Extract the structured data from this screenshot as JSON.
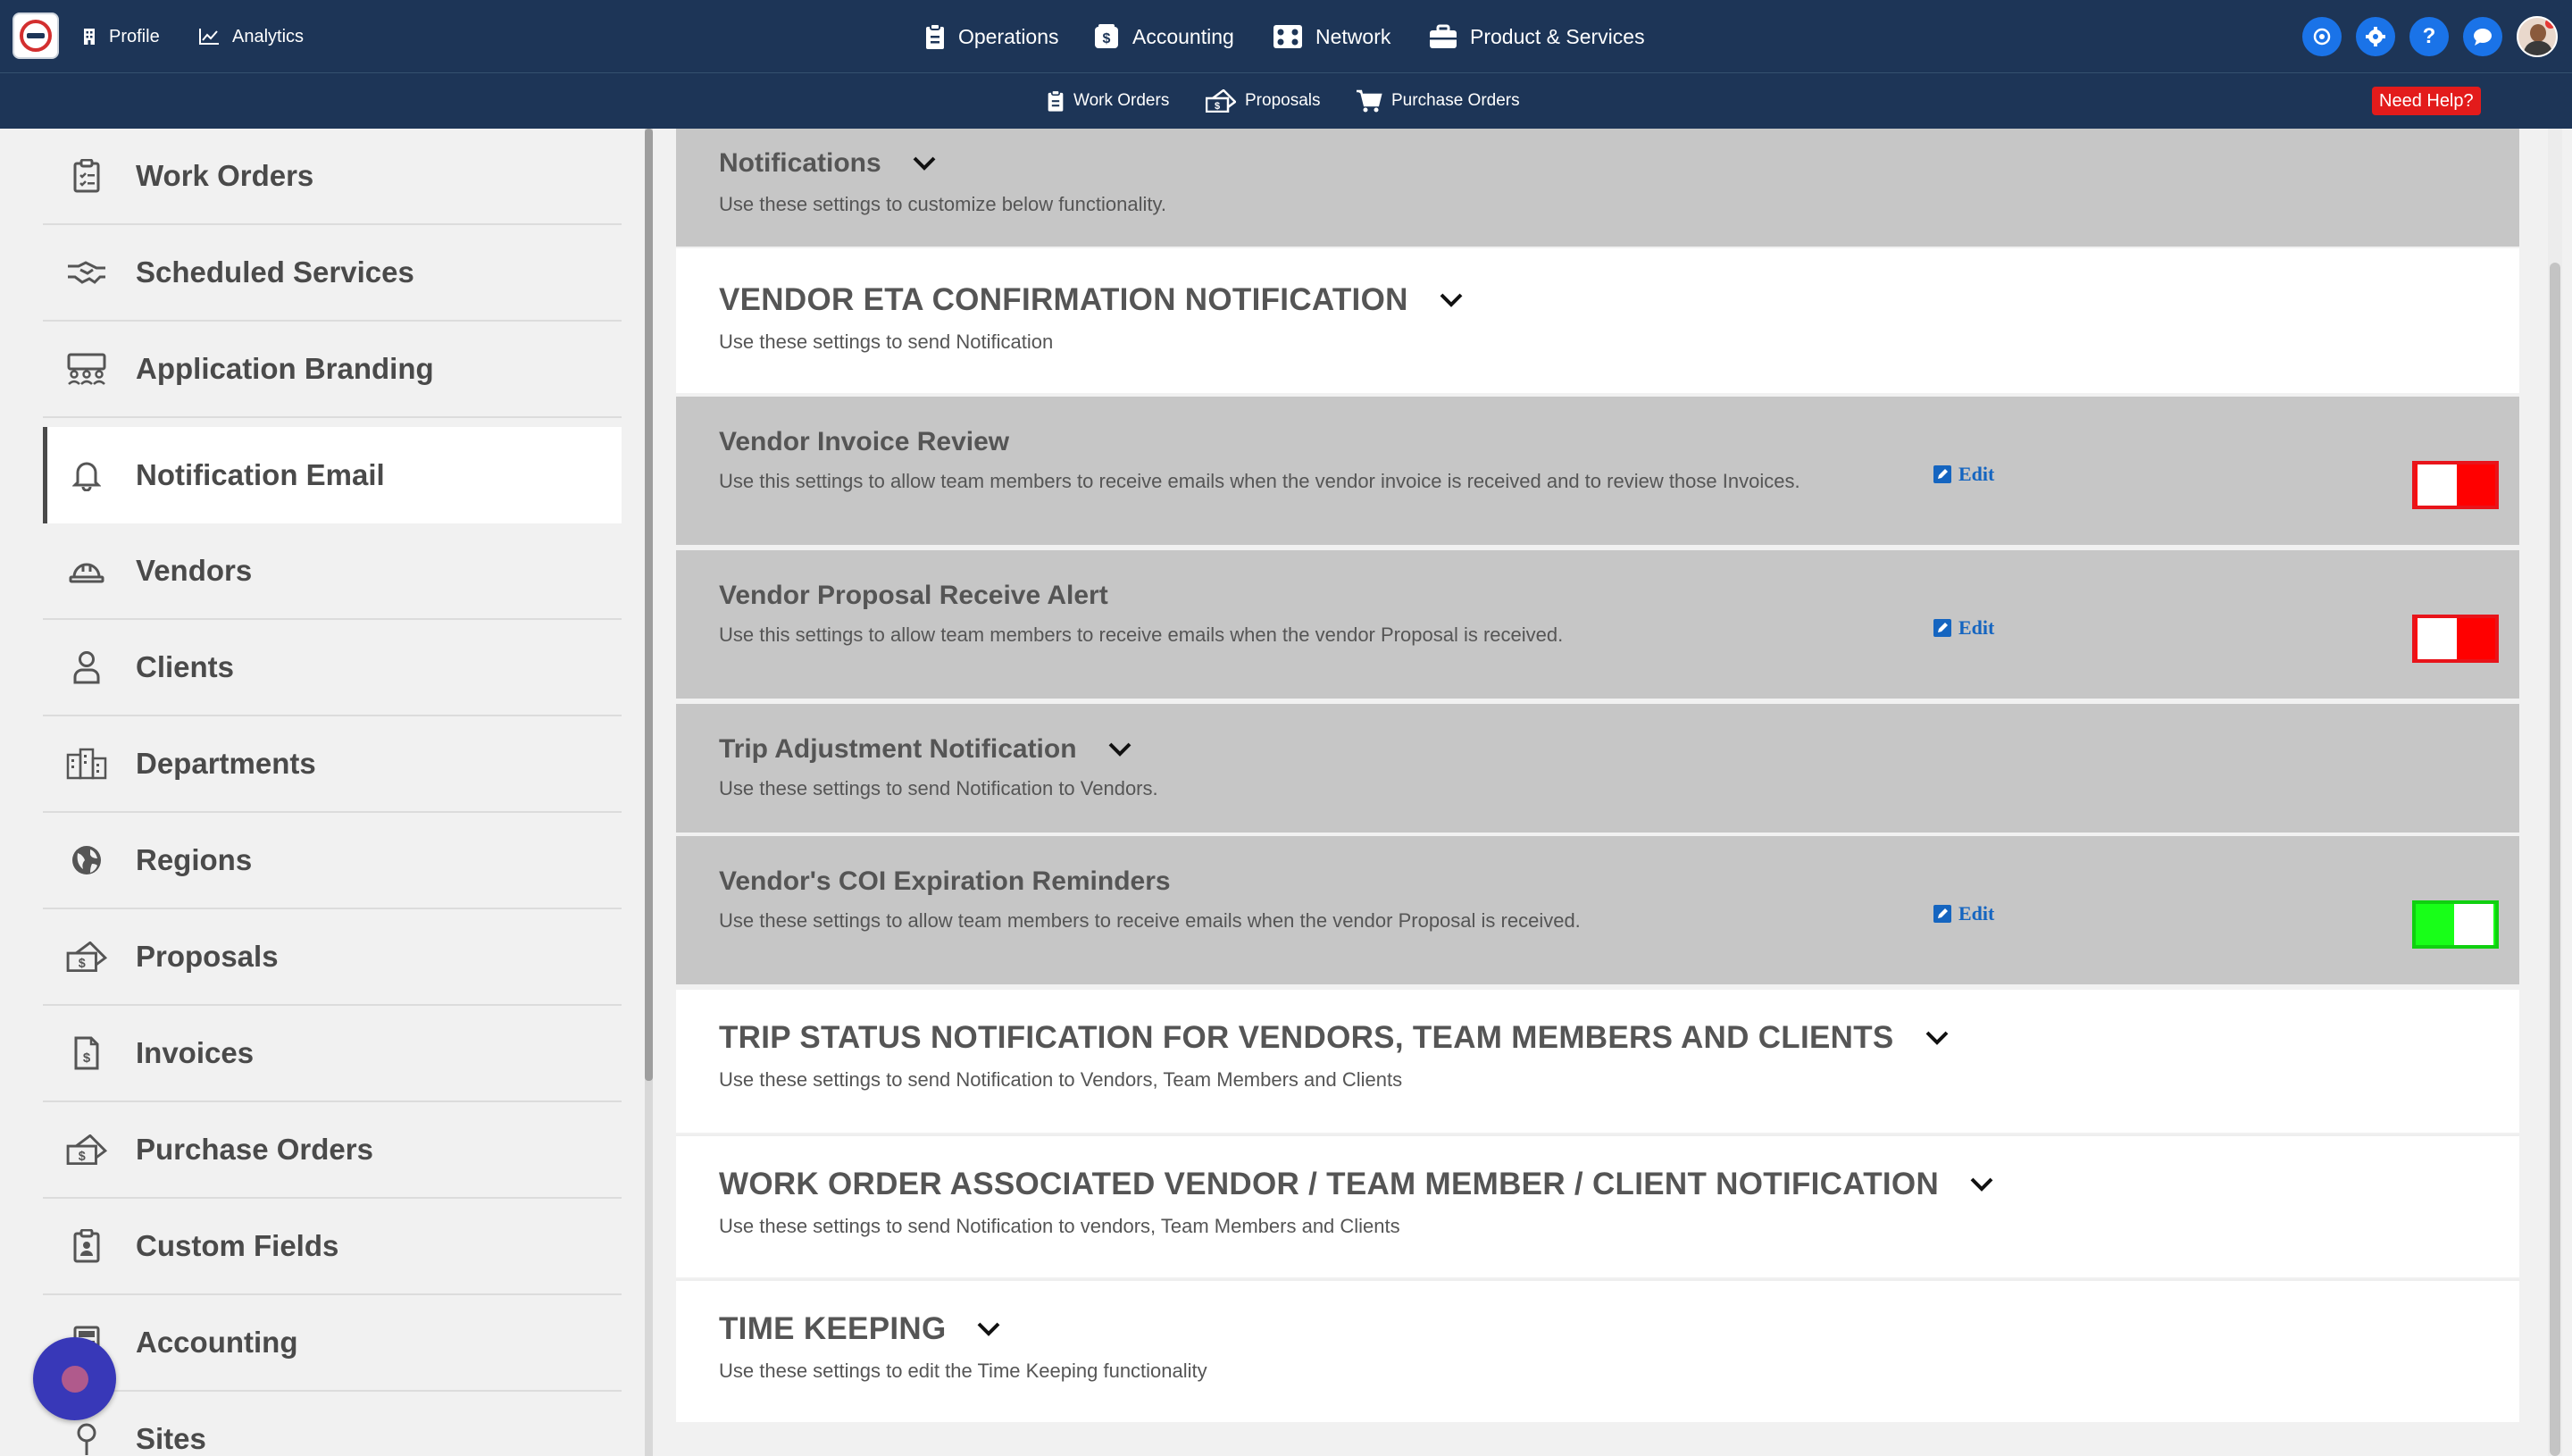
{
  "topbar": {
    "left": [
      {
        "label": "Profile",
        "icon": "building-icon"
      },
      {
        "label": "Analytics",
        "icon": "chart-line-icon"
      }
    ],
    "center": [
      {
        "label": "Operations",
        "icon": "clipboard-icon"
      },
      {
        "label": "Accounting",
        "icon": "calculator-dollar-icon"
      },
      {
        "label": "Network",
        "icon": "network-icon"
      },
      {
        "label": "Product & Services",
        "icon": "toolbox-icon"
      }
    ]
  },
  "subbar": {
    "items": [
      {
        "label": "Work Orders",
        "icon": "clipboard-icon"
      },
      {
        "label": "Proposals",
        "icon": "money-hand-icon"
      },
      {
        "label": "Purchase Orders",
        "icon": "cart-icon"
      }
    ],
    "help_label": "Need Help?"
  },
  "sidebar": {
    "items": [
      {
        "label": "Work Orders",
        "icon": "clipboard-list-icon",
        "active": false
      },
      {
        "label": "Scheduled Services",
        "icon": "handshake-icon",
        "active": false
      },
      {
        "label": "Application Branding",
        "icon": "people-board-icon",
        "active": false
      },
      {
        "label": "Notification Email",
        "icon": "bell-icon",
        "active": true
      },
      {
        "label": "Vendors",
        "icon": "hardhat-icon",
        "active": false
      },
      {
        "label": "Clients",
        "icon": "user-icon",
        "active": false
      },
      {
        "label": "Departments",
        "icon": "buildings-icon",
        "active": false
      },
      {
        "label": "Regions",
        "icon": "globe-icon",
        "active": false
      },
      {
        "label": "Proposals",
        "icon": "money-hand-icon",
        "active": false
      },
      {
        "label": "Invoices",
        "icon": "invoice-icon",
        "active": false
      },
      {
        "label": "Purchase Orders",
        "icon": "money-hand-icon",
        "active": false
      },
      {
        "label": "Custom Fields",
        "icon": "clipboard-user-icon",
        "active": false
      },
      {
        "label": "Accounting",
        "icon": "calculator-icon",
        "active": false
      },
      {
        "label": "Sites",
        "icon": "map-pin-icon",
        "active": false
      }
    ]
  },
  "main": {
    "edit_label": "Edit",
    "sections": [
      {
        "title": "Notifications",
        "desc": "Use these settings to customize below functionality.",
        "style": "gray",
        "caps": false,
        "chevron": true
      },
      {
        "title": "VENDOR ETA CONFIRMATION NOTIFICATION",
        "desc": "Use these settings to send Notification",
        "style": "white",
        "caps": true,
        "chevron": true
      },
      {
        "title": "Vendor Invoice Review",
        "desc": "Use this settings to allow team members to receive emails when the vendor invoice is received and to review those Invoices.",
        "style": "gray",
        "caps": false,
        "chevron": false,
        "editable": true,
        "toggle": "off"
      },
      {
        "title": "Vendor Proposal Receive Alert",
        "desc": "Use this settings to allow team members to receive emails when the vendor Proposal is received.",
        "style": "gray",
        "caps": false,
        "chevron": false,
        "editable": true,
        "toggle": "off"
      },
      {
        "title": "Trip Adjustment Notification",
        "desc": "Use these settings to send Notification to Vendors.",
        "style": "gray",
        "caps": false,
        "chevron": true
      },
      {
        "title": "Vendor's COI Expiration Reminders",
        "desc": "Use these settings to allow team members to receive emails when the vendor Proposal is received.",
        "style": "gray",
        "caps": false,
        "chevron": false,
        "editable": true,
        "toggle": "on"
      },
      {
        "title": "TRIP STATUS NOTIFICATION FOR VENDORS, TEAM MEMBERS AND CLIENTS",
        "desc": "Use these settings to send Notification to Vendors, Team Members and Clients",
        "style": "white",
        "caps": true,
        "chevron": true
      },
      {
        "title": "WORK ORDER ASSOCIATED VENDOR / TEAM MEMBER / CLIENT NOTIFICATION",
        "desc": "Use these settings to send Notification to vendors, Team Members and Clients",
        "style": "white",
        "caps": true,
        "chevron": true
      },
      {
        "title": "TIME KEEPING",
        "desc": "Use these settings to edit the Time Keeping functionality",
        "style": "white",
        "caps": true,
        "chevron": true
      }
    ]
  },
  "colors": {
    "navbar": "#1d3557",
    "toggle_off": "#ff0000",
    "toggle_on": "#18ff18",
    "help_badge": "#e31b1b",
    "edit_link": "#1565c0"
  }
}
